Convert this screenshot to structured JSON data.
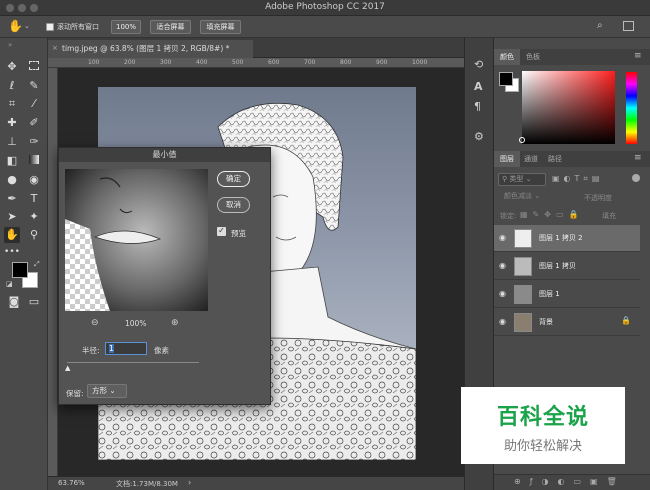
{
  "app": {
    "title": "Adobe Photoshop CC 2017"
  },
  "options_bar": {
    "scroll_all_windows_label": "滚动所有窗口",
    "zoom_100_label": "100%",
    "fit_screen_label": "适合屏幕",
    "fill_screen_label": "填充屏幕"
  },
  "document": {
    "tab_title": "timg.jpeg @ 63.8% (图层 1 拷贝 2, RGB/8#) *",
    "zoom_status": "63.76%",
    "doc_info": "文档:1.73M/8.30M",
    "ruler_ticks": [
      "100",
      "200",
      "300",
      "400",
      "500",
      "600",
      "700",
      "800",
      "900",
      "1000"
    ]
  },
  "toolbar": {
    "foreground_color": "#000000",
    "background_color": "#ffffff"
  },
  "color_panel": {
    "tabs": [
      "颜色",
      "色板"
    ]
  },
  "layers_panel": {
    "tabs": [
      "图层",
      "通道",
      "路径"
    ],
    "filter_label": "类型",
    "blend_mode": "颜色减淡",
    "opacity_label": "不透明度",
    "lock_label": "锁定:",
    "fill_label": "填充",
    "layers": [
      {
        "name": "图层 1 拷贝 2",
        "selected": true
      },
      {
        "name": "图层 1 拷贝",
        "selected": false
      },
      {
        "name": "图层 1",
        "selected": false
      },
      {
        "name": "背景",
        "selected": false
      }
    ]
  },
  "dialog": {
    "title": "最小值",
    "ok_label": "确定",
    "cancel_label": "取消",
    "preview_label": "预览",
    "preview_checked": true,
    "zoom_label": "100%",
    "radius_label": "半径:",
    "radius_value": "1",
    "radius_unit": "像素",
    "preserve_label": "保留:",
    "preserve_value": "方形"
  },
  "watermark": {
    "title": "百科全说",
    "subtitle": "助你轻松解决",
    "title_color": "#1aa34a"
  }
}
